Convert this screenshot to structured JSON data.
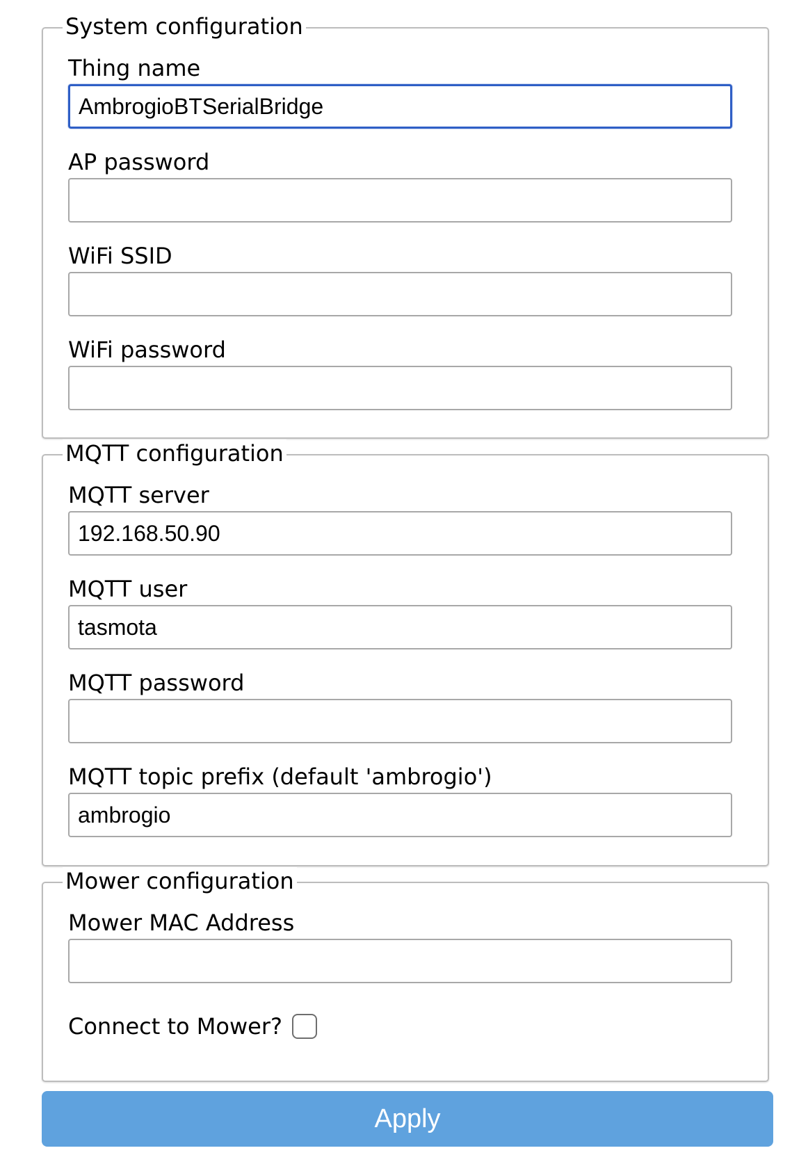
{
  "system": {
    "legend": "System configuration",
    "fields": [
      {
        "label": "Thing name",
        "value": "AmbrogioBTSerialBridge"
      },
      {
        "label": "AP password",
        "value": ""
      },
      {
        "label": "WiFi SSID",
        "value": ""
      },
      {
        "label": "WiFi password",
        "value": ""
      }
    ]
  },
  "mqtt": {
    "legend": "MQTT configuration",
    "fields": [
      {
        "label": "MQTT server",
        "value": "192.168.50.90"
      },
      {
        "label": "MQTT user",
        "value": "tasmota"
      },
      {
        "label": "MQTT password",
        "value": ""
      },
      {
        "label": "MQTT topic prefix (default 'ambrogio')",
        "value": "ambrogio"
      }
    ]
  },
  "mower": {
    "legend": "Mower configuration",
    "fields": [
      {
        "label": "Mower MAC Address",
        "value": ""
      }
    ],
    "connect_label": "Connect to Mower?",
    "connect_checked": false
  },
  "apply_label": "Apply",
  "colors": {
    "focus_border": "#2f5fc6",
    "button_bg": "#5fa2de",
    "fieldset_border": "#bdbdbd"
  }
}
